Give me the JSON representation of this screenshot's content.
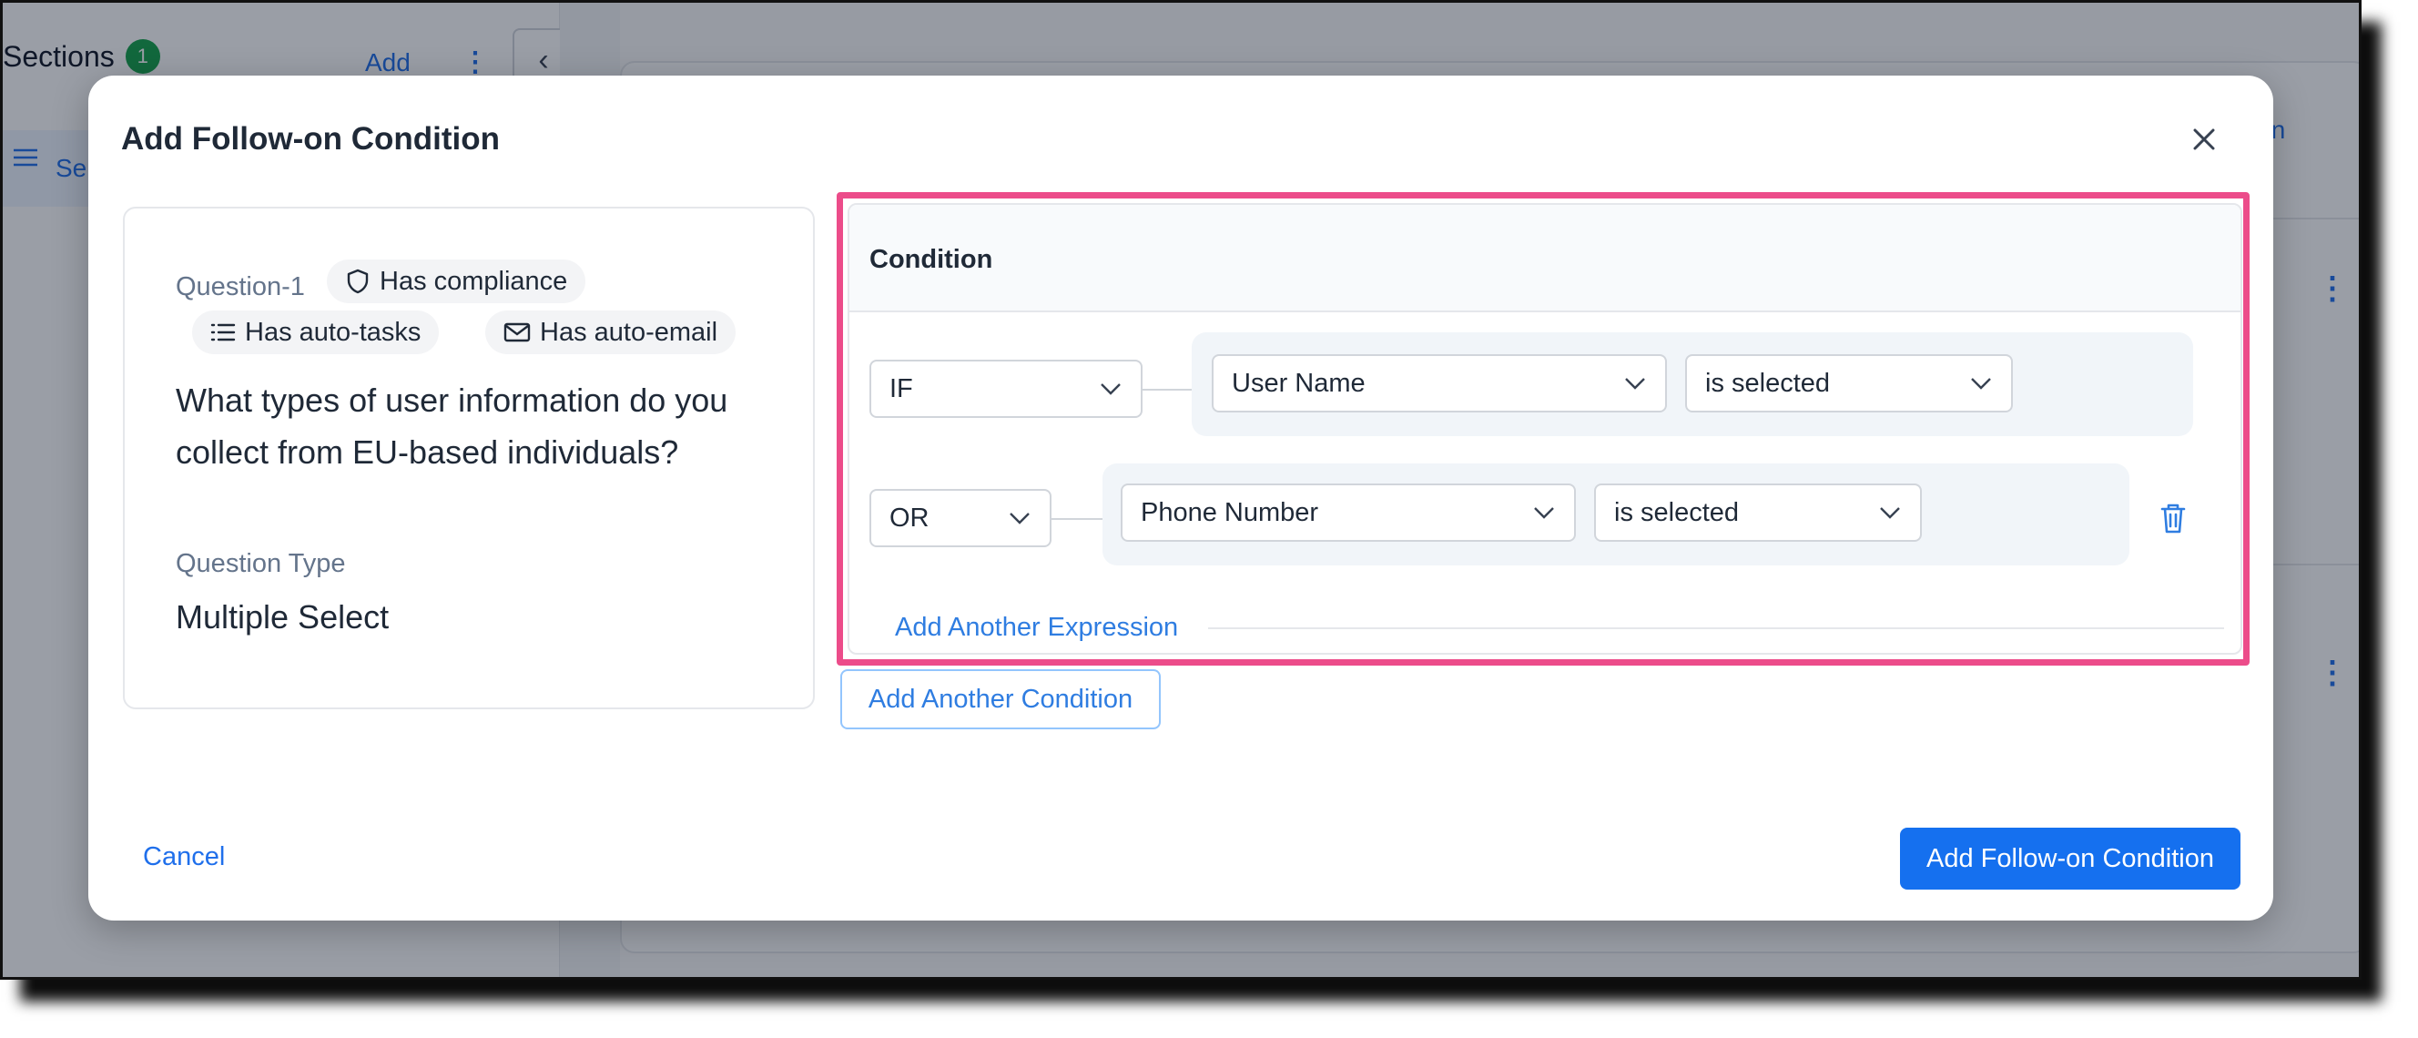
{
  "background": {
    "sections_title": "Sections",
    "sections_count": "1",
    "add_label": "Add",
    "kebab_glyph": "⋮",
    "collapse_glyph": "‹",
    "selected_item_label": "Se",
    "right_link_label": "ion"
  },
  "modal": {
    "title": "Add Follow-on Condition",
    "close_icon": "close-icon",
    "question": {
      "id_label": "Question-1",
      "tags": [
        {
          "label": "Has compliance",
          "icon": "shield-icon"
        },
        {
          "label": "Has auto-tasks",
          "icon": "list-icon"
        },
        {
          "label": "Has auto-email",
          "icon": "mail-icon"
        }
      ],
      "text": "What types of user information do you collect from EU-based individuals?",
      "type_label": "Question Type",
      "type_value": "Multiple Select"
    },
    "condition": {
      "title": "Condition",
      "expressions": [
        {
          "operator": "IF",
          "field": "User Name",
          "comparison": "is selected"
        },
        {
          "operator": "OR",
          "field": "Phone Number",
          "comparison": "is selected"
        }
      ],
      "add_expression_label": "Add Another Expression"
    },
    "add_condition_label": "Add Another Condition",
    "cancel_label": "Cancel",
    "submit_label": "Add Follow-on Condition"
  },
  "colors": {
    "accent": "#1570ef",
    "link": "#2f7de1",
    "highlight": "#ec4c8a",
    "badge": "#16a34a"
  }
}
